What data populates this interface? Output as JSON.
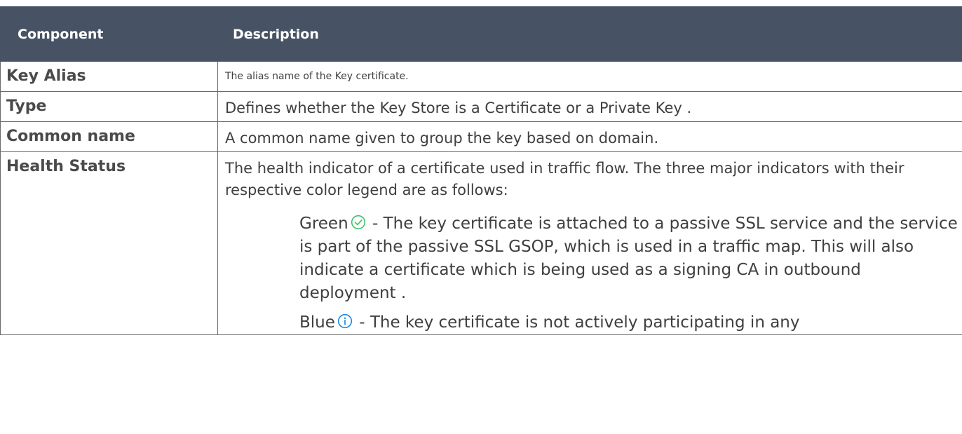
{
  "table": {
    "headers": {
      "component": "Component",
      "description": "Description"
    },
    "rows": [
      {
        "component": "Key Alias",
        "description": "The alias name of the Key certificate."
      },
      {
        "component": "Type",
        "description": "Defines whether the Key Store is a Certificate or a Private Key ."
      },
      {
        "component": "Common name",
        "description": "A common name given to group the key based on domain."
      },
      {
        "component": "Health Status",
        "description": "The health indicator of a certificate used in traffic flow. The three major indicators with their respective color legend are as follows:",
        "indicators": [
          {
            "color_label": "Green",
            "icon": "check-circle-icon",
            "icon_color": "#3cc46a",
            "text": " - The key certificate is attached to a passive SSL service and the service is part of the passive SSL GSOP, which is used in a traffic map. This will also indicate a certificate which is being used as a signing CA in outbound deployment ."
          },
          {
            "color_label": "Blue",
            "icon": "info-circle-icon",
            "icon_color": "#1e88e5",
            "text": " - The key certificate is not actively participating in any"
          }
        ]
      }
    ]
  },
  "colors": {
    "header_bg": "#475364",
    "header_text": "#ffffff",
    "border": "#6a6a6a"
  }
}
